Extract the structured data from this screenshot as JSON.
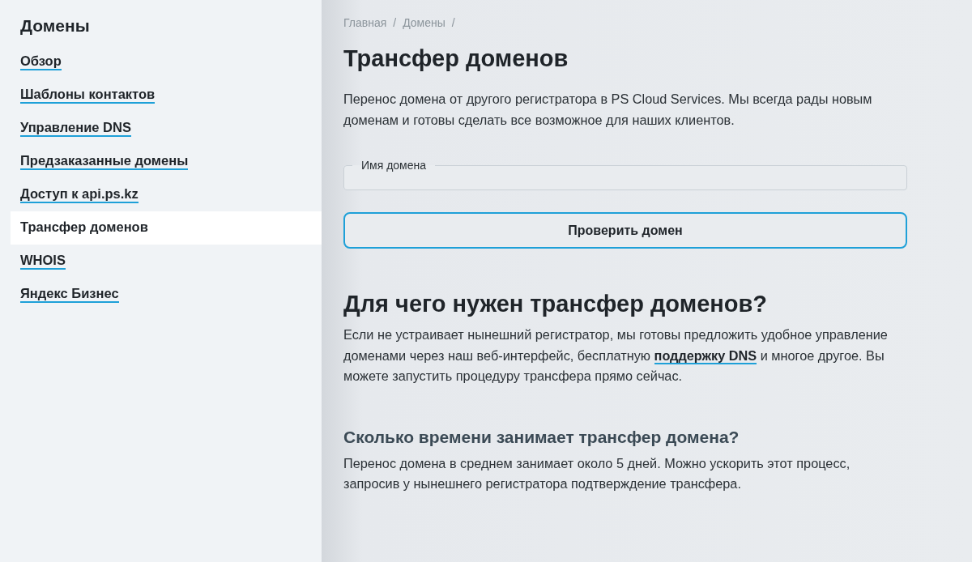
{
  "sidebar": {
    "title": "Домены",
    "items": [
      {
        "label": "Обзор",
        "selected": false
      },
      {
        "label": "Шаблоны контактов",
        "selected": false
      },
      {
        "label": "Управление DNS",
        "selected": false
      },
      {
        "label": "Предзаказанные домены",
        "selected": false
      },
      {
        "label": "Доступ к api.ps.kz",
        "selected": false
      },
      {
        "label": "Трансфер доменов",
        "selected": true
      },
      {
        "label": "WHOIS",
        "selected": false
      },
      {
        "label": "Яндекс Бизнес",
        "selected": false
      }
    ]
  },
  "breadcrumb": {
    "items": [
      "Главная",
      "Домены"
    ],
    "separator": "/"
  },
  "title": "Трансфер доменов",
  "intro": "Перенос домена от другого регистратора в PS Cloud Services. Мы всегда рады новым доменам и готовы сделать все возможное для наших клиентов.",
  "field": {
    "label": "Имя домена"
  },
  "button": "Проверить домен",
  "sections": [
    {
      "kind": "h2",
      "heading": "Для чего нужен трансфер доменов?",
      "text_before": "Если не устраивает нынешний регистратор, мы готовы предложить удобное управление доменами через наш веб-интерфейс, бесплатную",
      "link": "поддержку DNS",
      "text_after": "и многое другое. Вы можете запустить процедуру трансфера прямо сейчас."
    },
    {
      "kind": "h3",
      "heading": "Сколько времени занимает трансфер домена?",
      "text_before": "Перенос домена в среднем занимает около 5 дней. Можно ускорить этот процесс, запросив у нынешнего регистратора подтверждение трансфера."
    }
  ]
}
